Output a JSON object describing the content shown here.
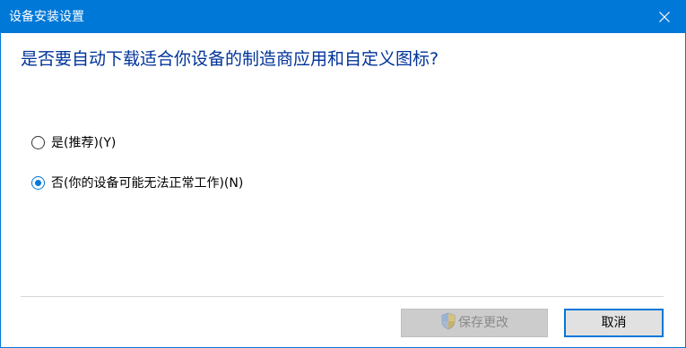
{
  "window": {
    "title": "设备安装设置"
  },
  "dialog": {
    "question": "是否要自动下载适合你设备的制造商应用和自定义图标?",
    "options": [
      {
        "label": "是(推荐)(Y)",
        "checked": false
      },
      {
        "label": "否(你的设备可能无法正常工作)(N)",
        "checked": true
      }
    ]
  },
  "buttons": {
    "save_label": "保存更改",
    "save_enabled": false,
    "cancel_label": "取消"
  },
  "icons": {
    "close": "close-icon",
    "shield": "uac-shield-icon"
  },
  "colors": {
    "accent": "#0078d7",
    "heading": "#003399"
  }
}
